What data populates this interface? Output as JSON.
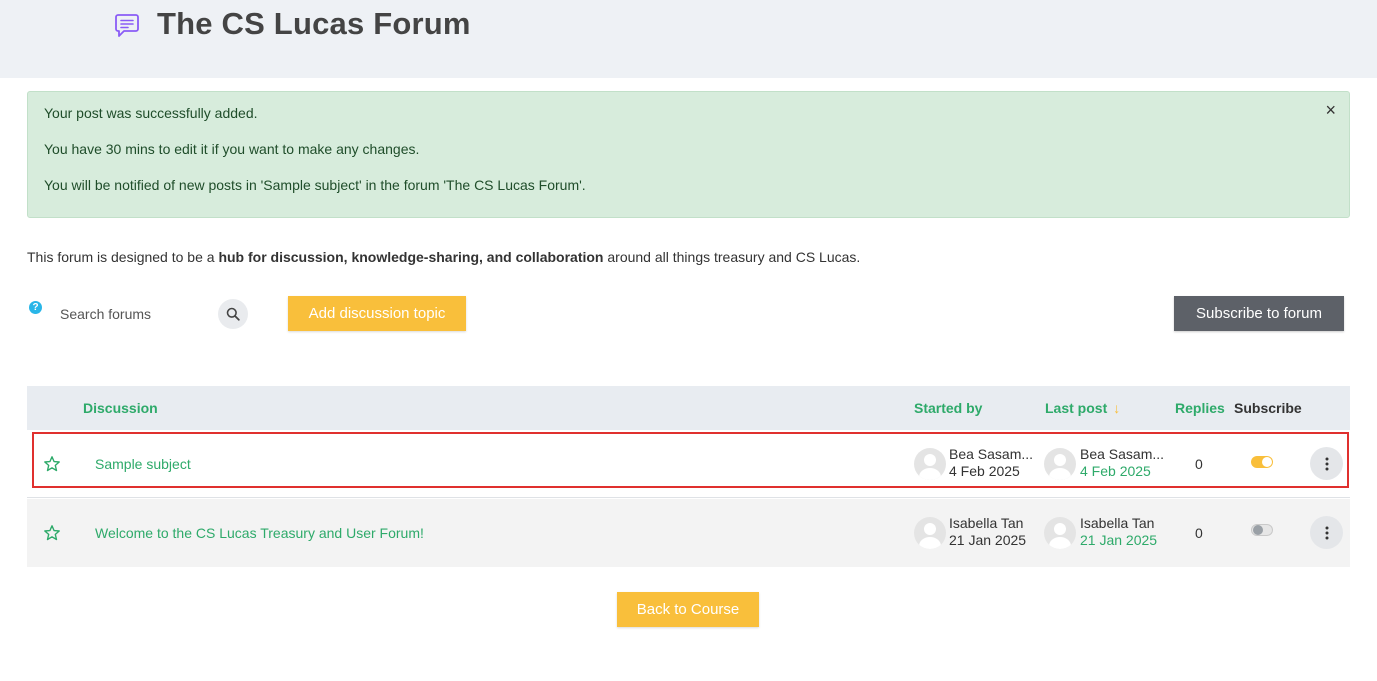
{
  "header": {
    "title": "The CS Lucas Forum",
    "icon": "chat-bubble-icon",
    "icon_color": "#8a5cf6"
  },
  "alert": {
    "line1": "Your post was successfully added.",
    "line2": "You have 30 mins to edit it if you want to make any changes.",
    "line3": "You will be notified of new posts in 'Sample subject' in the forum 'The CS Lucas Forum'.",
    "close_label": "×",
    "background": "#d7ecdc"
  },
  "intro": {
    "prefix": "This forum is designed to be a ",
    "bold": "hub for discussion, knowledge-sharing, and collaboration",
    "suffix": " around all things treasury and CS Lucas."
  },
  "toolbar": {
    "help_label": "?",
    "search_placeholder": "Search forums",
    "add_topic_label": "Add discussion topic",
    "subscribe_forum_label": "Subscribe to forum"
  },
  "table": {
    "headers": {
      "discussion": "Discussion",
      "started_by": "Started by",
      "last_post": "Last post",
      "last_post_sort": "↓",
      "replies": "Replies",
      "subscribe": "Subscribe"
    },
    "rows": [
      {
        "subject": "Sample subject",
        "started_name": "Bea Sasam...",
        "started_date": "4 Feb 2025",
        "last_name": "Bea Sasam...",
        "last_date": "4 Feb 2025",
        "replies": "0",
        "subscribed": true,
        "highlighted": true
      },
      {
        "subject": "Welcome to the CS Lucas Treasury and User Forum!",
        "started_name": "Isabella Tan",
        "started_date": "21 Jan 2025",
        "last_name": "Isabella Tan",
        "last_date": "21 Jan 2025",
        "replies": "0",
        "subscribed": false,
        "highlighted": false
      }
    ]
  },
  "footer": {
    "back_label": "Back to Course"
  },
  "colors": {
    "accent_green": "#2eaa6a",
    "accent_yellow": "#f9bf3b",
    "dark_button": "#5d6168",
    "highlight_border": "#e0302e"
  }
}
